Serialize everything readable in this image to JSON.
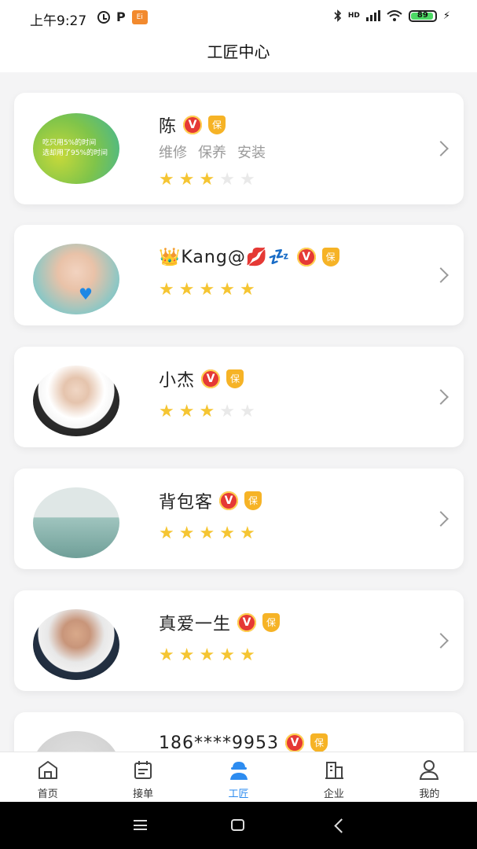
{
  "status_bar": {
    "time": "上午9:27",
    "app_icon_text": "Ei",
    "network": "HD",
    "battery": "89"
  },
  "header": {
    "title": "工匠中心"
  },
  "craftsmen": [
    {
      "name": "陈",
      "tags": [
        "维修",
        "保养",
        "安装"
      ],
      "rating": 3,
      "badge_v": "V",
      "badge_bao": "保",
      "avatar_text": [
        "吃只用5%的时间",
        "选却用了95%的时间"
      ]
    },
    {
      "name": "👑Kang@💋💤",
      "tags": [],
      "rating": 5,
      "badge_v": "V",
      "badge_bao": "保",
      "avatar_text": []
    },
    {
      "name": "小杰",
      "tags": [],
      "rating": 3,
      "badge_v": "V",
      "badge_bao": "保",
      "avatar_text": []
    },
    {
      "name": "背包客",
      "tags": [],
      "rating": 5,
      "badge_v": "V",
      "badge_bao": "保",
      "avatar_text": []
    },
    {
      "name": "真爱一生",
      "tags": [],
      "rating": 5,
      "badge_v": "V",
      "badge_bao": "保",
      "avatar_text": []
    },
    {
      "name": "186****9953",
      "tags": [],
      "rating": 0,
      "badge_v": "V",
      "badge_bao": "保",
      "avatar_text": []
    }
  ],
  "bottom_nav": [
    {
      "label": "首页",
      "icon": "home-icon"
    },
    {
      "label": "接单",
      "icon": "calendar-icon"
    },
    {
      "label": "工匠",
      "icon": "worker-icon",
      "active": true
    },
    {
      "label": "企业",
      "icon": "building-icon"
    },
    {
      "label": "我的",
      "icon": "person-icon"
    }
  ],
  "colors": {
    "accent": "#2d8cf0",
    "star": "#f5c532",
    "badge_red": "#e53935",
    "badge_gold": "#f6b326"
  }
}
